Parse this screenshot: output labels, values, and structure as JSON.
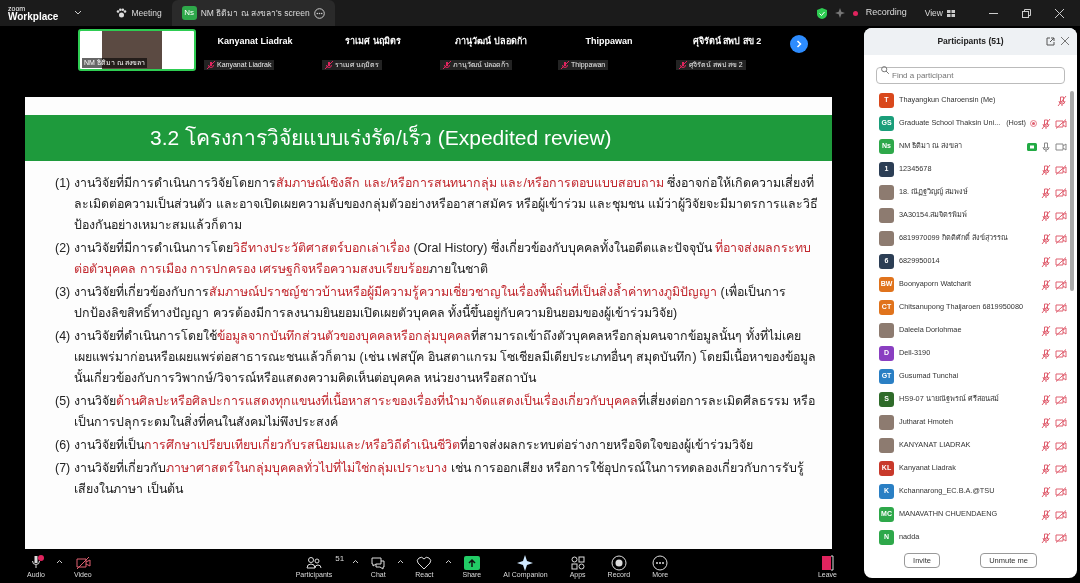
{
  "app": {
    "logo_small": "zoom",
    "logo_large": "Workplace"
  },
  "tabs": [
    {
      "label": "Meeting",
      "selected": false,
      "kind": "meeting"
    },
    {
      "label": "NM ธิติมา ณ สงขลา's screen",
      "selected": true,
      "kind": "screen",
      "initials": "Ns"
    }
  ],
  "top_right": {
    "recording": "Recording",
    "view": "View"
  },
  "video_strip": {
    "speaker": {
      "label": "NM ธิติมา ณ สงขลา",
      "active": true
    },
    "tiles": [
      {
        "name": "Kanyanat Liadrak",
        "label": "Kanyanat Liadrak",
        "muted": true
      },
      {
        "name": "ราเมศ นฤมิตร",
        "label": "ราเมศ นฤมิตร",
        "muted": true
      },
      {
        "name": "ภานุวัฒน์  ปลอดก้า",
        "label": "ภานุวัฒน์  ปลอดก้า",
        "muted": true
      },
      {
        "name": "Thippawan",
        "label": "Thippawan",
        "muted": true
      },
      {
        "name": "ศุจิรัตน์ สพป สข 2",
        "label": "ศุจิรัตน์ สพป สข 2",
        "muted": true
      }
    ]
  },
  "slide": {
    "title": "3.2 โครงการวิจัยแบบเร่งรัด/เร็ว (Expedited review)",
    "items": [
      {
        "number": "(1)",
        "segments": [
          {
            "text": "งานวิจัยที่มีการดำเนินการวิจัยโดยการ",
            "emphasis": false
          },
          {
            "text": "สัมภาษณ์เชิงลึก และ/หรือการสนทนากลุ่ม และ/หรือการตอบแบบสอบถาม",
            "emphasis": true
          },
          {
            "text": " ซึ่งอาจก่อให้เกิดความเสี่ยงที่ละเมิดต่อความเป็นส่วนตัว และอาจเปิดเผยความลับของกลุ่มตัวอย่างหรืออาสาสมัคร หรือผู้เข้าร่วม และชุมชน แม้ว่าผู้วิจัยจะมีมาตรการและวิธีป้องกันอย่างเหมาะสมแล้วก็ตาม",
            "emphasis": false
          }
        ]
      },
      {
        "number": "(2)",
        "segments": [
          {
            "text": "งานวิจัยที่มีการดำเนินการโดย",
            "emphasis": false
          },
          {
            "text": "วิธีทางประวัติศาสตร์บอกเล่าเรื่อง",
            "emphasis": true
          },
          {
            "text": " (Oral History) ซึ่งเกี่ยวข้องกับบุคคลทั้งในอดีตและปัจจุบัน ",
            "emphasis": false
          },
          {
            "text": "ที่อาจส่งผลกระทบต่อตัวบุคคล การเมือง การปกครอง เศรษฐกิจหรือความสงบเรียบร้อย",
            "emphasis": true
          },
          {
            "text": "ภายในชาติ",
            "emphasis": false
          }
        ]
      },
      {
        "number": "(3)",
        "segments": [
          {
            "text": "งานวิจัยที่เกี่ยวข้องกับการ",
            "emphasis": false
          },
          {
            "text": "สัมภาษณ์ปราชญ์ชาวบ้านหรือผู้มีความรู้ความเชี่ยวชาญในเรื่องพื้นถิ่นที่เป็นสิ่งล้ำค่าทางภูมิปัญญา",
            "emphasis": true
          },
          {
            "text": " (เพื่อเป็นการปกป้องลิขสิทธิ์ทางปัญญา ควรต้องมีการลงนามยินยอมเปิดเผยตัวบุคคล ทั้งนี้ขึ้นอยู่กับความยินยอมของผู้เข้าร่วมวิจัย)",
            "emphasis": false
          }
        ]
      },
      {
        "number": "(4)",
        "segments": [
          {
            "text": "งานวิจัยที่ดำเนินการโดยใช้",
            "emphasis": false
          },
          {
            "text": "ข้อมูลจากบันทึกส่วนตัวของบุคคลหรือกลุ่มบุคคล",
            "emphasis": true
          },
          {
            "text": "ที่สามารถเข้าถึงตัวบุคคลหรือกลุ่มคนจากข้อมูลนั้นๆ ทั้งที่ไม่เคยเผยแพร่มาก่อนหรือเผยแพร่ต่อสาธารณะชนแล้วก็ตาม (เช่น เฟสบุ๊ค อินสตาแกรม โซเชียลมีเดียประเภทอื่นๆ สมุดบันทึก) โดยมีเนื้อหาของข้อมูลนั้นเกี่ยวข้องกับการวิพากษ์/วิจารณ์หรือแสดงความคิดเห็นต่อบุคคล หน่วยงานหรือสถาบัน",
            "emphasis": false
          }
        ]
      },
      {
        "number": "(5)",
        "segments": [
          {
            "text": "งานวิจัย",
            "emphasis": false
          },
          {
            "text": "ด้านศิลปะหรือศิลปะการแสดงทุกแขนงที่เนื้อหาสาระของเรื่องที่นำมาจัดแสดงเป็นเรื่องเกี่ยวกับบุคคล",
            "emphasis": true
          },
          {
            "text": "ที่เสี่ยงต่อการละเมิดศีลธรรม หรือเป็นการปลุกระดมในสิ่งที่คนในสังคมไม่พึงประสงค์",
            "emphasis": false
          }
        ]
      },
      {
        "number": "(6)",
        "segments": [
          {
            "text": "งานวิจัยที่เป็น",
            "emphasis": false
          },
          {
            "text": "การศึกษาเปรียบเทียบเกี่ยวกับรสนิยมและ/หรือวิถีดำเนินชีวิต",
            "emphasis": true
          },
          {
            "text": "ที่อาจส่งผลกระทบต่อร่างกายหรือจิตใจของผู้เข้าร่วมวิจัย",
            "emphasis": false
          }
        ]
      },
      {
        "number": "(7)",
        "segments": [
          {
            "text": "งานวิจัยที่เกี่ยวกับ",
            "emphasis": false
          },
          {
            "text": "ภาษาศาสตร์ในกลุ่มบุคคลทั่วไปที่ไม่ใช่กลุ่มเปราะบาง",
            "emphasis": true
          },
          {
            "text": " เช่น การออกเสียง หรือการใช้อุปกรณ์ในการทดลองเกี่ยวกับการรับรู้เสียงในภาษา เป็นต้น",
            "emphasis": false
          }
        ]
      }
    ]
  },
  "participants": {
    "title": "Participants (51)",
    "search": {
      "placeholder": "Find a participant"
    },
    "people": [
      {
        "name": "Thayangkun Charoensin (Me)",
        "kind": "initials",
        "initials": "T",
        "color": "#d9481c",
        "muted": true
      },
      {
        "name": "Graduate School Thaksin Uni...",
        "role": "(Host)",
        "kind": "initials",
        "initials": "GS",
        "color": "#1a9e7a",
        "recording": true,
        "muted": true,
        "video": false
      },
      {
        "name": "NM ธิติมา ณ สงขลา",
        "kind": "initials",
        "initials": "Ns",
        "color": "#2ea84a",
        "sharing": true,
        "muted": false,
        "video": true
      },
      {
        "name": "12345678",
        "kind": "initials",
        "initials": "1",
        "color": "#2c3e55",
        "muted": true,
        "video": false
      },
      {
        "name": "18. ณัฏฐวิญญ์ สมพงษ์",
        "kind": "photo",
        "muted": true,
        "video": false
      },
      {
        "name": "3A30154.สมจิตรพิมพ์",
        "kind": "photo",
        "muted": true,
        "video": false
      },
      {
        "name": "6819970099 กิตติศักดิ์ สังข์สุวรรณ",
        "kind": "photo",
        "muted": true,
        "video": false
      },
      {
        "name": "6829950014",
        "kind": "initials",
        "initials": "6",
        "color": "#2c3e55",
        "muted": true,
        "video": false
      },
      {
        "name": "Boonyaporn Watcharit",
        "kind": "initials",
        "initials": "BW",
        "color": "#e0731c",
        "muted": true,
        "video": false
      },
      {
        "name": "Chitsanupong Thaijaroen 6819950080",
        "kind": "initials",
        "initials": "CT",
        "color": "#e0731c",
        "muted": true,
        "video": false
      },
      {
        "name": "Daleela Dorlohmae",
        "kind": "photo",
        "muted": true,
        "video": false
      },
      {
        "name": "Dell-3190",
        "kind": "initials",
        "initials": "D",
        "color": "#8a3fc1",
        "muted": true,
        "video": false
      },
      {
        "name": "Gusumad Tunchai",
        "kind": "initials",
        "initials": "GT",
        "color": "#2a7fc4",
        "muted": true,
        "video": false
      },
      {
        "name": "HS9-07 นายณัฐพรณ์ ศรีสอนสม์",
        "kind": "initials",
        "initials": "S",
        "color": "#2f6b2a",
        "muted": true,
        "video": false
      },
      {
        "name": "Jutharat Hmoteh",
        "kind": "photo",
        "muted": true,
        "video": false
      },
      {
        "name": "KANYANAT LIADRAK",
        "kind": "photo",
        "muted": true,
        "video": false
      },
      {
        "name": "Kanyanat Liadrak",
        "kind": "initials",
        "initials": "KL",
        "color": "#c8392b",
        "muted": true,
        "video": false
      },
      {
        "name": "Kchannarong_EC.B.A.@TSU",
        "kind": "initials",
        "initials": "K",
        "color": "#2a7fc4",
        "muted": true,
        "video": false
      },
      {
        "name": "MANAVATHN CHUENDAENG",
        "kind": "initials",
        "initials": "MC",
        "color": "#2ea84a",
        "muted": true,
        "video": false
      },
      {
        "name": "nadda",
        "kind": "initials",
        "initials": "N",
        "color": "#2ea84a",
        "muted": true,
        "video": false
      }
    ],
    "buttons": [
      "Invite",
      "Unmute me"
    ]
  },
  "toolbar": [
    {
      "label": "Audio",
      "kind": "mic",
      "alert": true,
      "caret": true
    },
    {
      "label": "Video",
      "kind": "video",
      "caret": false
    },
    {
      "label": "Participants",
      "kind": "people",
      "count": "51",
      "caret": true
    },
    {
      "label": "Chat",
      "kind": "chat",
      "caret": true
    },
    {
      "label": "React",
      "kind": "heart",
      "caret": true
    },
    {
      "label": "Share",
      "kind": "share",
      "caret": false
    },
    {
      "label": "AI Companion",
      "kind": "sparkle",
      "caret": false
    },
    {
      "label": "Apps",
      "kind": "apps",
      "caret": false
    },
    {
      "label": "Record",
      "kind": "record",
      "caret": false
    },
    {
      "label": "More",
      "kind": "more",
      "caret": false
    },
    {
      "label": "Leave",
      "kind": "leave",
      "caret": false
    }
  ]
}
